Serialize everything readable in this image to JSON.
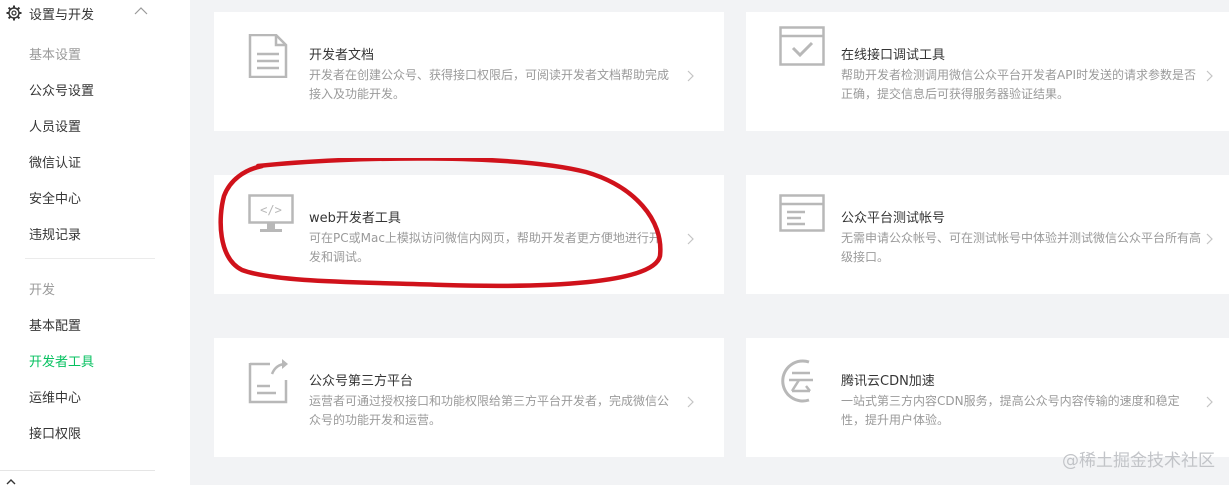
{
  "sidebar": {
    "header_title": "设置与开发",
    "group1_title": "基本设置",
    "group1_items": [
      "公众号设置",
      "人员设置",
      "微信认证",
      "安全中心",
      "违规记录"
    ],
    "group2_title": "开发",
    "group2_items": [
      "基本配置",
      "开发者工具",
      "运维中心",
      "接口权限"
    ],
    "active_item": "开发者工具"
  },
  "cards": [
    {
      "title": "开发者文档",
      "desc": "开发者在创建公众号、获得接口权限后，可阅读开发者文档帮助完成接入及功能开发。",
      "icon": "document-icon"
    },
    {
      "title": "在线接口调试工具",
      "desc": "帮助开发者检测调用微信公众平台开发者API时发送的请求参数是否正确，提交信息后可获得服务器验证结果。",
      "icon": "browser-check-icon"
    },
    {
      "title": "web开发者工具",
      "desc": "可在PC或Mac上模拟访问微信内网页，帮助开发者更方便地进行开发和调试。",
      "icon": "monitor-code-icon"
    },
    {
      "title": "公众平台测试帐号",
      "desc": "无需申请公众帐号、可在测试帐号中体验并测试微信公众平台所有高级接口。",
      "icon": "browser-list-icon"
    },
    {
      "title": "公众号第三方平台",
      "desc": "运营者可通过授权接口和功能权限给第三方平台开发者，完成微信公众号的功能开发和运营。",
      "icon": "document-share-icon"
    },
    {
      "title": "腾讯云CDN加速",
      "desc": "一站式第三方内容CDN服务，提高公众号内容传输的速度和稳定性，提升用户体验。",
      "icon": "cloud-logo-icon"
    }
  ],
  "watermark": "@稀土掘金技术社区",
  "colors": {
    "accent": "#07c160",
    "annotation": "#d0121b",
    "icon": "#b8b8b8"
  }
}
